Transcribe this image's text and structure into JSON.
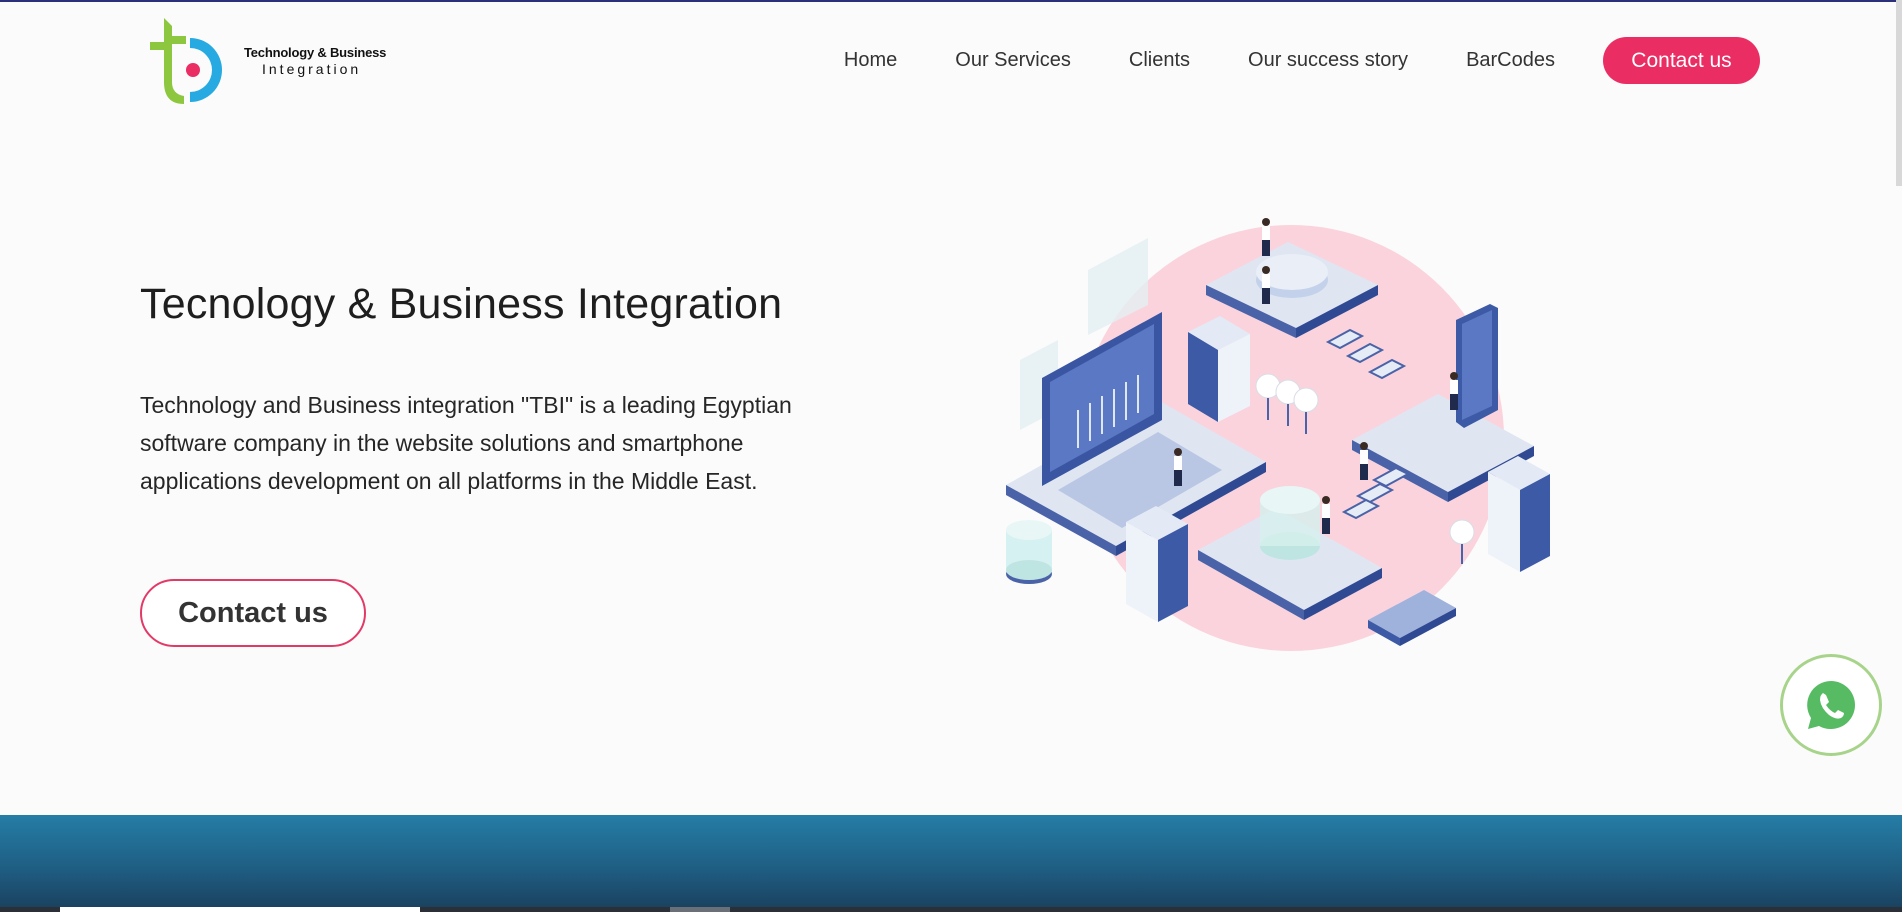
{
  "colors": {
    "accent": "#ea2d63",
    "logo_green": "#8dc63f",
    "logo_blue": "#27aae1",
    "band": "#1f5e83",
    "whatsapp": "#57bb63"
  },
  "header": {
    "logo": {
      "line1": "Technology & Business",
      "line2": "Integration",
      "icon": "tbi-logo-icon"
    },
    "nav": [
      {
        "label": "Home"
      },
      {
        "label": "Our Services"
      },
      {
        "label": "Clients"
      },
      {
        "label": "Our success story"
      },
      {
        "label": "BarCodes"
      }
    ],
    "cta_label": "Contact us"
  },
  "hero": {
    "title": "Tecnology & Business Integration",
    "description": "Technology and Business integration \"TBI\" is a leading Egyptian software company in the website solutions and smartphone applications development on all platforms in the Middle East.",
    "cta_label": "Contact us",
    "illustration": "isometric-tech-illustration"
  },
  "floating": {
    "whatsapp_icon": "whatsapp-icon"
  }
}
